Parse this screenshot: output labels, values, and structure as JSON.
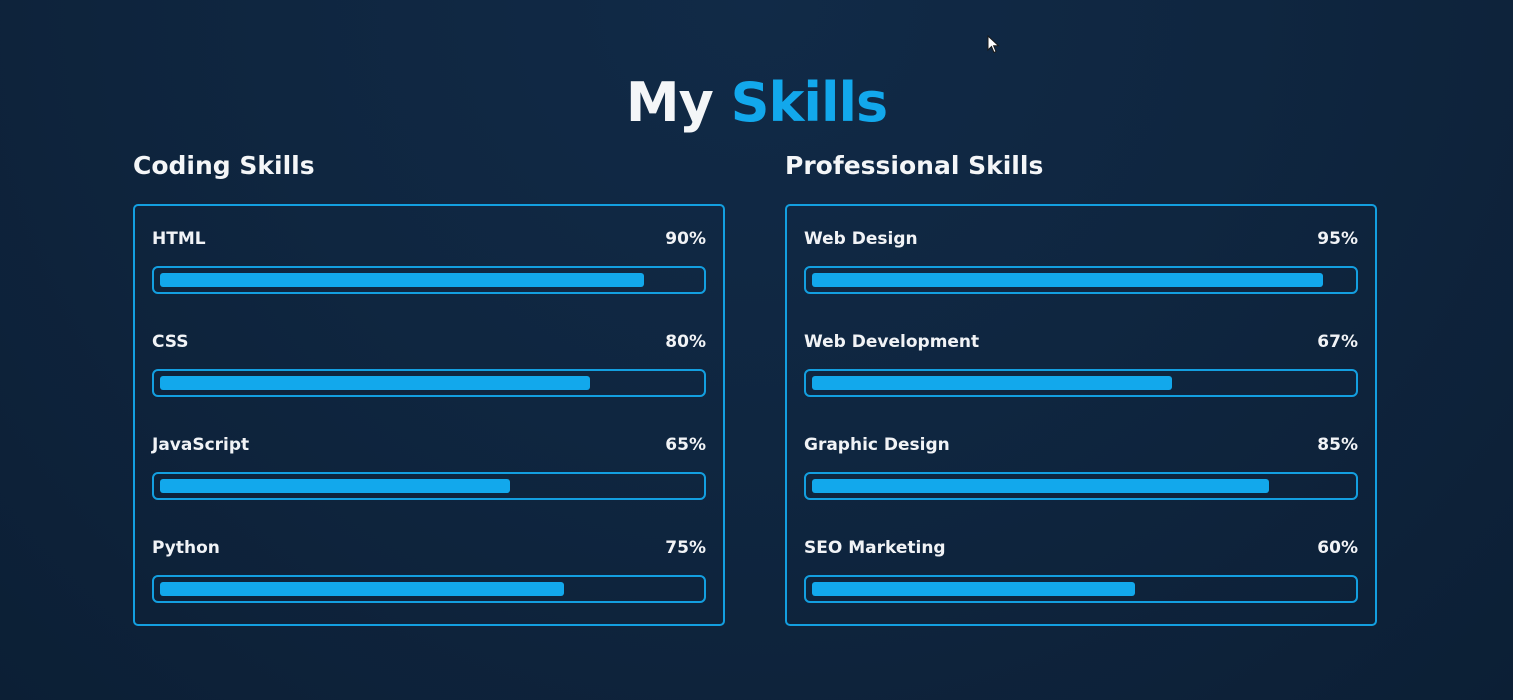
{
  "title": {
    "part1": "My",
    "part2": "Skills"
  },
  "colors": {
    "accent": "#12a8ec",
    "background": "#0f2640",
    "text": "#f4f6f8"
  },
  "sections": [
    {
      "heading": "Coding Skills",
      "skills": [
        {
          "name": "HTML",
          "percent_label": "90%",
          "value": 90
        },
        {
          "name": "CSS",
          "percent_label": "80%",
          "value": 80
        },
        {
          "name": "JavaScript",
          "percent_label": "65%",
          "value": 65
        },
        {
          "name": "Python",
          "percent_label": "75%",
          "value": 75
        }
      ]
    },
    {
      "heading": "Professional Skills",
      "skills": [
        {
          "name": "Web Design",
          "percent_label": "95%",
          "value": 95
        },
        {
          "name": "Web Development",
          "percent_label": "67%",
          "value": 67
        },
        {
          "name": "Graphic Design",
          "percent_label": "85%",
          "value": 85
        },
        {
          "name": "SEO Marketing",
          "percent_label": "60%",
          "value": 60
        }
      ]
    }
  ],
  "cursor_icon": "mouse-pointer-icon"
}
